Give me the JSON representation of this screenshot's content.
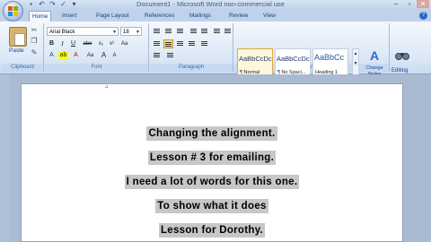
{
  "window": {
    "title": "Document1 - Microsoft Word non-commercial use"
  },
  "tabs": [
    "Home",
    "Insert",
    "Page Layout",
    "References",
    "Mailings",
    "Review",
    "View"
  ],
  "active_tab": "Home",
  "clipboard": {
    "paste_label": "Paste",
    "group_label": "Clipboard"
  },
  "font": {
    "name": "Arial Black",
    "size": "18",
    "group_label": "Font",
    "grow": "A",
    "shrink": "A",
    "bold": "B",
    "italic": "I",
    "underline": "U",
    "strike": "abe",
    "subscript": "x₂",
    "superscript": "x²",
    "case": "Aa",
    "clear": "Aa"
  },
  "paragraph": {
    "group_label": "Paragraph",
    "alignment": "center"
  },
  "styles": {
    "group_label": "Styles",
    "items": [
      {
        "sample": "AaBbCcDc",
        "name": "¶ Normal",
        "selected": true
      },
      {
        "sample": "AaBbCcDc",
        "name": "¶ No Spaci...",
        "selected": false
      },
      {
        "sample": "AaBbCc",
        "name": "Heading 1",
        "selected": false
      }
    ],
    "change_label": "Change Styles"
  },
  "editing": {
    "label": "Editing"
  },
  "document": {
    "lines": [
      "Changing the alignment.",
      "Lesson # 3 for emailing.",
      "I need a lot of words for this one.",
      "To show what it does",
      "Lesson for Dorothy."
    ]
  },
  "colors": {
    "accent": "#15428b",
    "ribbon": "#dce8f6",
    "selection_highlight": "#c7c7c7",
    "workspace": "#a9bad2"
  }
}
